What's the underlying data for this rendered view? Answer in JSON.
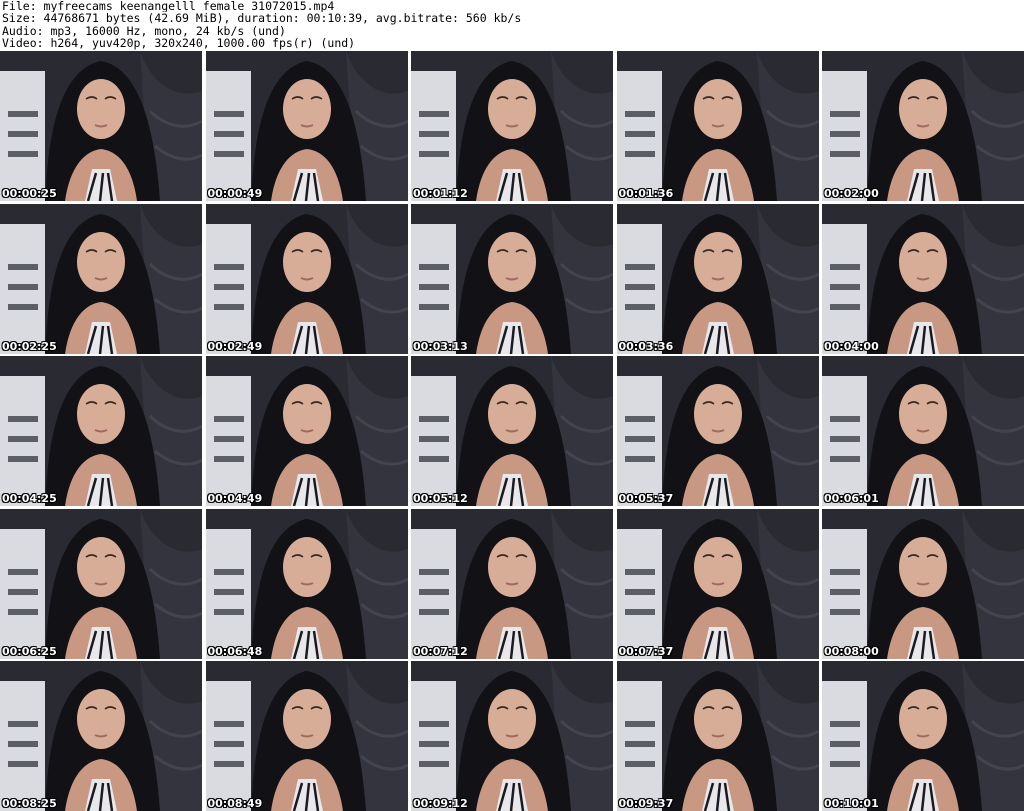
{
  "header": {
    "file_line": "File: myfreecams_keenangelll_female_31072015.mp4",
    "size_line": "Size: 44768671 bytes (42.69 MiB), duration: 00:10:39, avg.bitrate: 560 kb/s",
    "audio_line": "Audio: mp3, 16000 Hz, mono, 24 kb/s (und)",
    "video_line": "Video: h264, yuv420p, 320x240, 1000.00 fps(r) (und)"
  },
  "thumbnails": [
    {
      "timestamp": "00:00:25"
    },
    {
      "timestamp": "00:00:49"
    },
    {
      "timestamp": "00:01:12"
    },
    {
      "timestamp": "00:01:36"
    },
    {
      "timestamp": "00:02:00"
    },
    {
      "timestamp": "00:02:25"
    },
    {
      "timestamp": "00:02:49"
    },
    {
      "timestamp": "00:03:13"
    },
    {
      "timestamp": "00:03:36"
    },
    {
      "timestamp": "00:04:00"
    },
    {
      "timestamp": "00:04:25"
    },
    {
      "timestamp": "00:04:49"
    },
    {
      "timestamp": "00:05:12"
    },
    {
      "timestamp": "00:05:37"
    },
    {
      "timestamp": "00:06:01"
    },
    {
      "timestamp": "00:06:25"
    },
    {
      "timestamp": "00:06:48"
    },
    {
      "timestamp": "00:07:12"
    },
    {
      "timestamp": "00:07:37"
    },
    {
      "timestamp": "00:08:00"
    },
    {
      "timestamp": "00:08:25"
    },
    {
      "timestamp": "00:08:49"
    },
    {
      "timestamp": "00:09:12"
    },
    {
      "timestamp": "00:09:37"
    },
    {
      "timestamp": "00:10:01"
    }
  ]
}
